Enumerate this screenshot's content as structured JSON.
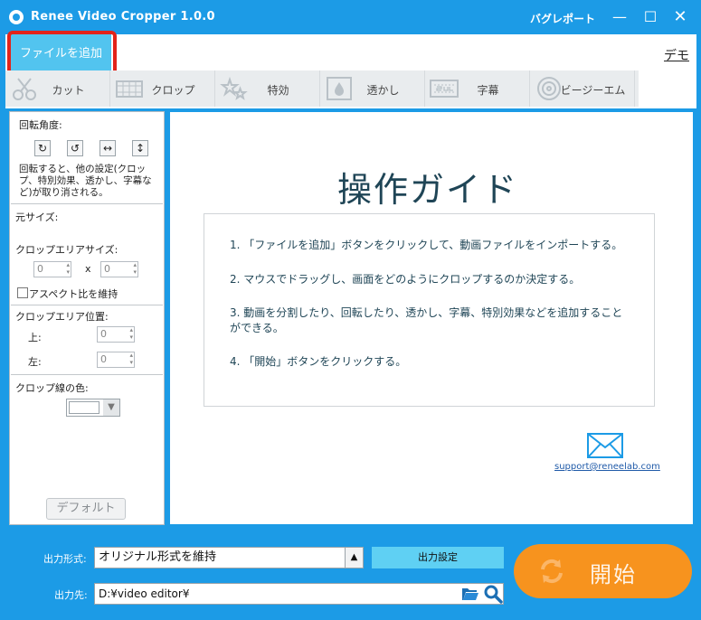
{
  "window": {
    "title": "Renee Video Cropper 1.0.0",
    "bug_report": "バグレポート",
    "minimize_glyph": "—",
    "maximize_glyph": "☐",
    "close_glyph": "✕"
  },
  "toolbar": {
    "add_file": "ファイルを追加",
    "demo": "デモ",
    "tabs": [
      {
        "label": "カット",
        "icon": "cut-icon"
      },
      {
        "label": "クロップ",
        "icon": "crop-icon"
      },
      {
        "label": "特効",
        "icon": "effects-icon"
      },
      {
        "label": "透かし",
        "icon": "watermark-icon"
      },
      {
        "label": "字幕",
        "icon": "subtitle-icon"
      },
      {
        "label": "ビージーエム",
        "icon": "bgm-icon"
      }
    ]
  },
  "left_panel": {
    "rotation_label": "回転角度:",
    "rotation_buttons": [
      "↻",
      "↺",
      "↔",
      "↕"
    ],
    "rotation_note": "回転すると、他の設定(クロップ、特別効果、透かし、字幕など)が取り消される。",
    "original_size_label": "元サイズ:",
    "crop_area_size_label": "クロップエリアサイズ:",
    "crop_width": "0",
    "crop_height": "0",
    "size_separator": "x",
    "keep_aspect_label": "アスペクト比を維持",
    "crop_position_label": "クロップエリア位置:",
    "top_label": "上:",
    "top_value": "0",
    "left_label": "左:",
    "left_value": "0",
    "crop_line_color_label": "クロップ線の色:",
    "crop_line_color": "#ffffff",
    "default_button": "デフォルト"
  },
  "guide": {
    "title": "操作ガイド",
    "steps": [
      "1. 「ファイルを追加」ボタンをクリックして、動画ファイルをインポートする。",
      "2. マウスでドラッグし、画面をどのようにクロップするのか決定する。",
      "3. 動画を分割したり、回転したり、透かし、字幕、特別効果などを追加することができる。",
      "4. 「開始」ボタンをクリックする。"
    ],
    "support_email": "support@reneelab.com"
  },
  "bottom": {
    "output_format_label": "出力形式:",
    "output_format_value": "オリジナル形式を維持",
    "output_settings_button": "出力設定",
    "output_dest_label": "出力先:",
    "output_dest_value": "D:¥video editor¥",
    "start_button": "開始"
  },
  "colors": {
    "frame_blue": "#1c9be6",
    "add_file_bg": "#52c4ef",
    "highlight_red": "#e2231a",
    "start_orange": "#f7931e",
    "guide_text": "#1f4556"
  }
}
